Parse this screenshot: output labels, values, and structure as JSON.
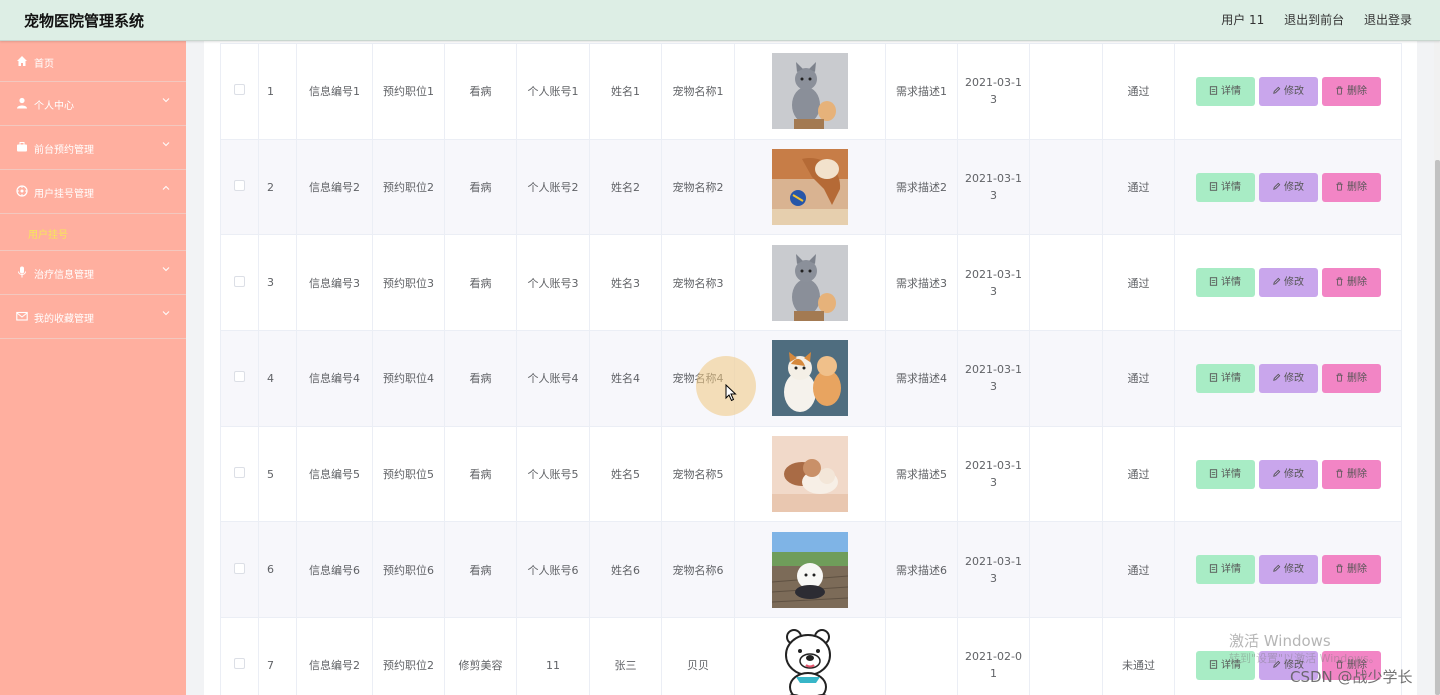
{
  "app_title": "宠物医院管理系统",
  "header": {
    "user": "用户 11",
    "to_front": "退出到前台",
    "logout": "退出登录"
  },
  "sidebar": {
    "items": [
      {
        "label": "首页",
        "icon": "home-icon"
      },
      {
        "label": "个人中心",
        "icon": "user-icon"
      },
      {
        "label": "前台预约管理",
        "icon": "briefcase-icon"
      },
      {
        "label": "用户挂号管理",
        "icon": "compass-icon",
        "expanded": true,
        "children": [
          {
            "label": "用户挂号"
          }
        ]
      },
      {
        "label": "治疗信息管理",
        "icon": "microphone-icon"
      },
      {
        "label": "我的收藏管理",
        "icon": "mail-icon"
      }
    ]
  },
  "table": {
    "rows": [
      {
        "index": "1",
        "info_no": "信息编号1",
        "position": "预约职位1",
        "service": "看病",
        "account": "个人账号1",
        "name": "姓名1",
        "pet": "宠物名称1",
        "image": "gray-cat",
        "desc": "需求描述1",
        "date": "2021-03-13",
        "blank": "",
        "status": "通过"
      },
      {
        "index": "2",
        "info_no": "信息编号2",
        "position": "预约职位2",
        "service": "看病",
        "account": "个人账号2",
        "name": "姓名2",
        "pet": "宠物名称2",
        "image": "cat-with-ball",
        "desc": "需求描述2",
        "date": "2021-03-13",
        "blank": "",
        "status": "通过"
      },
      {
        "index": "3",
        "info_no": "信息编号3",
        "position": "预约职位3",
        "service": "看病",
        "account": "个人账号3",
        "name": "姓名3",
        "pet": "宠物名称3",
        "image": "gray-cat",
        "desc": "需求描述3",
        "date": "2021-03-13",
        "blank": "",
        "status": "通过"
      },
      {
        "index": "4",
        "info_no": "信息编号4",
        "position": "预约职位4",
        "service": "看病",
        "account": "个人账号4",
        "name": "姓名4",
        "pet": "宠物名称4",
        "image": "calico-cats",
        "desc": "需求描述4",
        "date": "2021-03-13",
        "blank": "",
        "status": "通过"
      },
      {
        "index": "5",
        "info_no": "信息编号5",
        "position": "预约职位5",
        "service": "看病",
        "account": "个人账号5",
        "name": "姓名5",
        "pet": "宠物名称5",
        "image": "sleeping-kittens",
        "desc": "需求描述5",
        "date": "2021-03-13",
        "blank": "",
        "status": "通过"
      },
      {
        "index": "6",
        "info_no": "信息编号6",
        "position": "预约职位6",
        "service": "看病",
        "account": "个人账号6",
        "name": "姓名6",
        "pet": "宠物名称6",
        "image": "white-dog",
        "desc": "需求描述6",
        "date": "2021-03-13",
        "blank": "",
        "status": "通过"
      },
      {
        "index": "7",
        "info_no": "信息编号2",
        "position": "预约职位2",
        "service": "修剪美容",
        "account": "11",
        "name": "张三",
        "pet": "贝贝",
        "image": "cartoon-bear",
        "desc": "",
        "date": "2021-02-01",
        "blank": "",
        "status": "未通过"
      }
    ],
    "actions": {
      "detail": "详情",
      "edit": "修改",
      "delete": "删除"
    }
  },
  "watermark": {
    "line1": "激活 Windows",
    "line2": "转到\"设置\"以激活 Windows。",
    "csdn": "CSDN @战少学长"
  },
  "colors": {
    "header_bg": "#ddeee5",
    "sidebar_bg": "#ffaf9f",
    "submenu_active": "#f7e65a",
    "detail_btn": "#a8ecc5",
    "edit_btn": "#c9a6ec",
    "delete_btn": "#f285c5"
  }
}
